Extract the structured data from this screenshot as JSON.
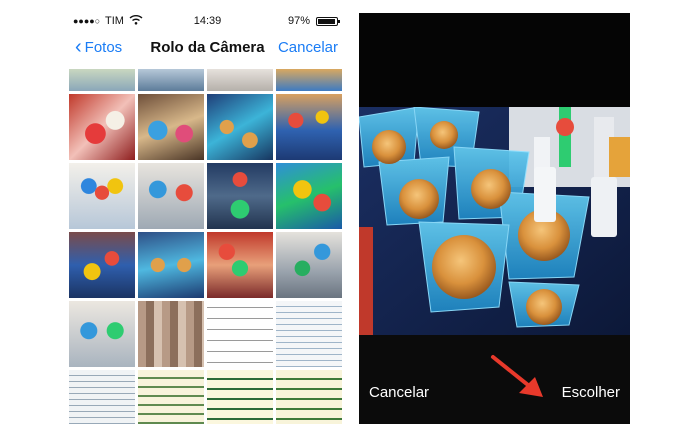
{
  "status_bar": {
    "signal": "●●●●○",
    "carrier": "TIM",
    "time": "14:39",
    "battery_percent": "97%"
  },
  "nav": {
    "back_label": "Fotos",
    "title": "Rolo da Câmera",
    "cancel_label": "Cancelar"
  },
  "grid": {
    "thumbnails": [
      {
        "desc": "party-table"
      },
      {
        "desc": "party-table"
      },
      {
        "desc": "party-table"
      },
      {
        "desc": "party-table"
      },
      {
        "desc": "party-table"
      },
      {
        "desc": "party-table"
      },
      {
        "desc": "party-table"
      },
      {
        "desc": "party-table"
      },
      {
        "desc": "party-table"
      },
      {
        "desc": "party-table"
      },
      {
        "desc": "party-table"
      },
      {
        "desc": "party-table"
      },
      {
        "desc": "party-table"
      },
      {
        "desc": "party-table"
      },
      {
        "desc": "party-table"
      },
      {
        "desc": "party-table"
      },
      {
        "desc": "party-table"
      },
      {
        "desc": "blurred-photo"
      },
      {
        "desc": "document"
      },
      {
        "desc": "screenshot"
      },
      {
        "desc": "screenshot"
      },
      {
        "desc": "handwritten-note"
      },
      {
        "desc": "handwritten-note"
      },
      {
        "desc": "handwritten-note"
      }
    ]
  },
  "preview": {
    "cancel_label": "Cancelar",
    "choose_label": "Escolher"
  },
  "colors": {
    "ios_blue": "#1a7cf5",
    "arrow_red": "#e8392b"
  }
}
